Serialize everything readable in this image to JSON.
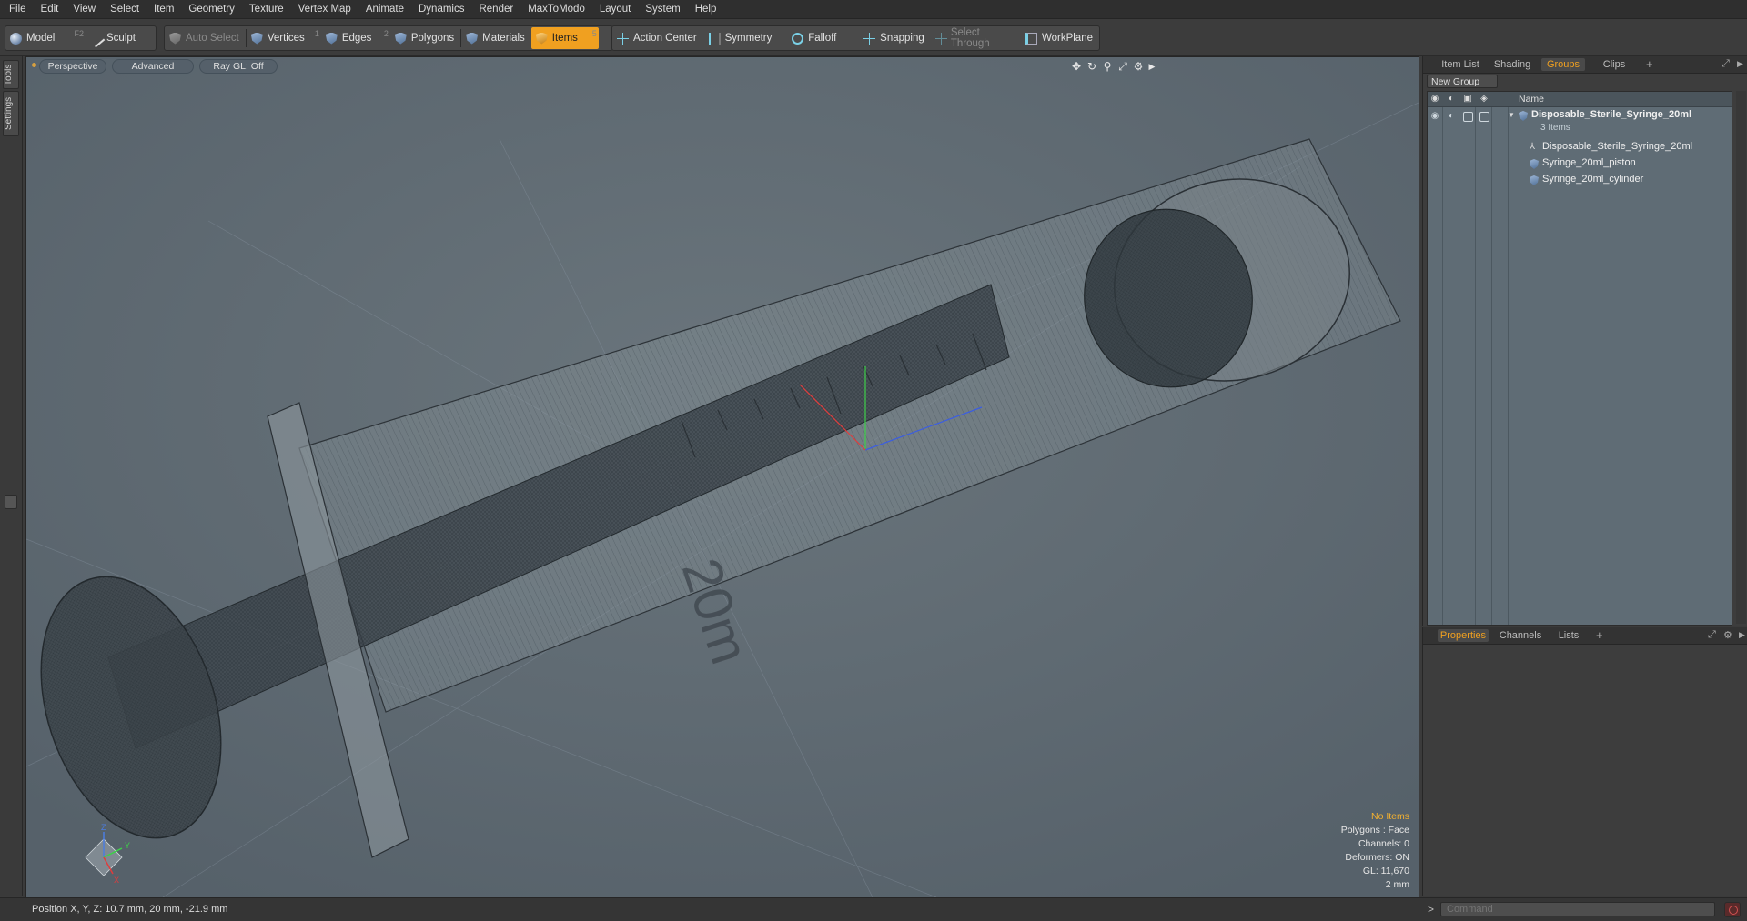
{
  "menu": [
    "File",
    "Edit",
    "View",
    "Select",
    "Item",
    "Geometry",
    "Texture",
    "Vertex Map",
    "Animate",
    "Dynamics",
    "Render",
    "MaxToModo",
    "Layout",
    "System",
    "Help"
  ],
  "toolbar": {
    "model": "Model",
    "model_key": "F2",
    "sculpt": "Sculpt",
    "auto_select": "Auto Select",
    "vertices": "Vertices",
    "vertices_key": "1",
    "edges": "Edges",
    "edges_key": "2",
    "polygons": "Polygons",
    "materials": "Materials",
    "items": "Items",
    "items_key": "5",
    "action_center": "Action Center",
    "symmetry": "Symmetry",
    "falloff": "Falloff",
    "snapping": "Snapping",
    "select_through": "Select Through",
    "workplane": "WorkPlane"
  },
  "left_tabs": {
    "tools": "Tools",
    "settings": "Settings"
  },
  "viewport": {
    "view": "Perspective",
    "shading": "Advanced",
    "raygl": "Ray GL: Off",
    "label_20ml": "20m",
    "info": {
      "items": "No Items",
      "polygons": "Polygons : Face",
      "channels": "Channels: 0",
      "deformers": "Deformers: ON",
      "gl": "GL: 11,670",
      "scale": "2 mm"
    },
    "axes": {
      "x": "X",
      "y": "Y",
      "z": "Z"
    }
  },
  "right_top": {
    "tabs": [
      "Item List",
      "Shading",
      "Groups",
      "Clips"
    ],
    "active_tab": "Groups",
    "new_group": "New Group",
    "col_name": "Name",
    "group_name": "Disposable_Sterile_Syringe_20ml",
    "group_count": "3 Items",
    "children": [
      "Disposable_Sterile_Syringe_20ml",
      "Syringe_20ml_piston",
      "Syringe_20ml_cylinder"
    ]
  },
  "right_bottom": {
    "tabs": [
      "Properties",
      "Channels",
      "Lists"
    ],
    "active_tab": "Properties"
  },
  "status": {
    "position": "Position X, Y, Z:  10.7 mm, 20 mm, -21.9 mm"
  },
  "command": {
    "placeholder": "Command"
  },
  "colors": {
    "accent": "#f0a020",
    "viewport_bg": "#5e6a72",
    "panel_bg": "#3d3d3d"
  }
}
